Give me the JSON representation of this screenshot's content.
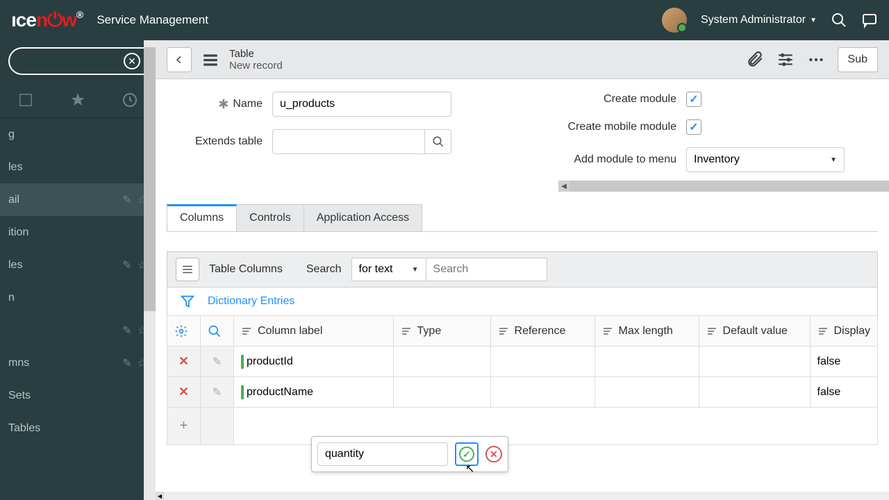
{
  "header": {
    "app_title": "Service Management",
    "user_name": "System Administrator"
  },
  "nav": {
    "items": [
      {
        "label": "g",
        "actions": false
      },
      {
        "label": "les",
        "actions": false
      },
      {
        "label": "ail",
        "actions": true,
        "selected": true
      },
      {
        "label": "ition",
        "actions": false
      },
      {
        "label": "les",
        "actions": true
      },
      {
        "label": "n",
        "actions": false
      },
      {
        "label": "",
        "actions": true
      },
      {
        "label": "mns",
        "actions": true
      },
      {
        "label": "Sets",
        "actions": false
      },
      {
        "label": "Tables",
        "actions": false
      }
    ]
  },
  "main_header": {
    "title": "Table",
    "subtitle": "New record",
    "submit_label": "Sub"
  },
  "form": {
    "name_label": "Name",
    "name_value": "u_products",
    "extends_label": "Extends table",
    "extends_value": "",
    "create_module_label": "Create module",
    "create_mobile_label": "Create mobile module",
    "add_menu_label": "Add module to menu",
    "add_menu_value": "Inventory"
  },
  "tabs": [
    {
      "label": "Columns",
      "active": true
    },
    {
      "label": "Controls",
      "active": false
    },
    {
      "label": "Application Access",
      "active": false
    }
  ],
  "table_toolbar": {
    "title": "Table Columns",
    "search_label": "Search",
    "search_mode": "for text",
    "search_placeholder": "Search"
  },
  "filter": {
    "link": "Dictionary Entries"
  },
  "columns": [
    "Column label",
    "Type",
    "Reference",
    "Max length",
    "Default value",
    "Display"
  ],
  "rows": [
    {
      "label": "productId",
      "display": "false"
    },
    {
      "label": "productName",
      "display": "false"
    }
  ],
  "inline_edit": {
    "value": "quantity"
  }
}
